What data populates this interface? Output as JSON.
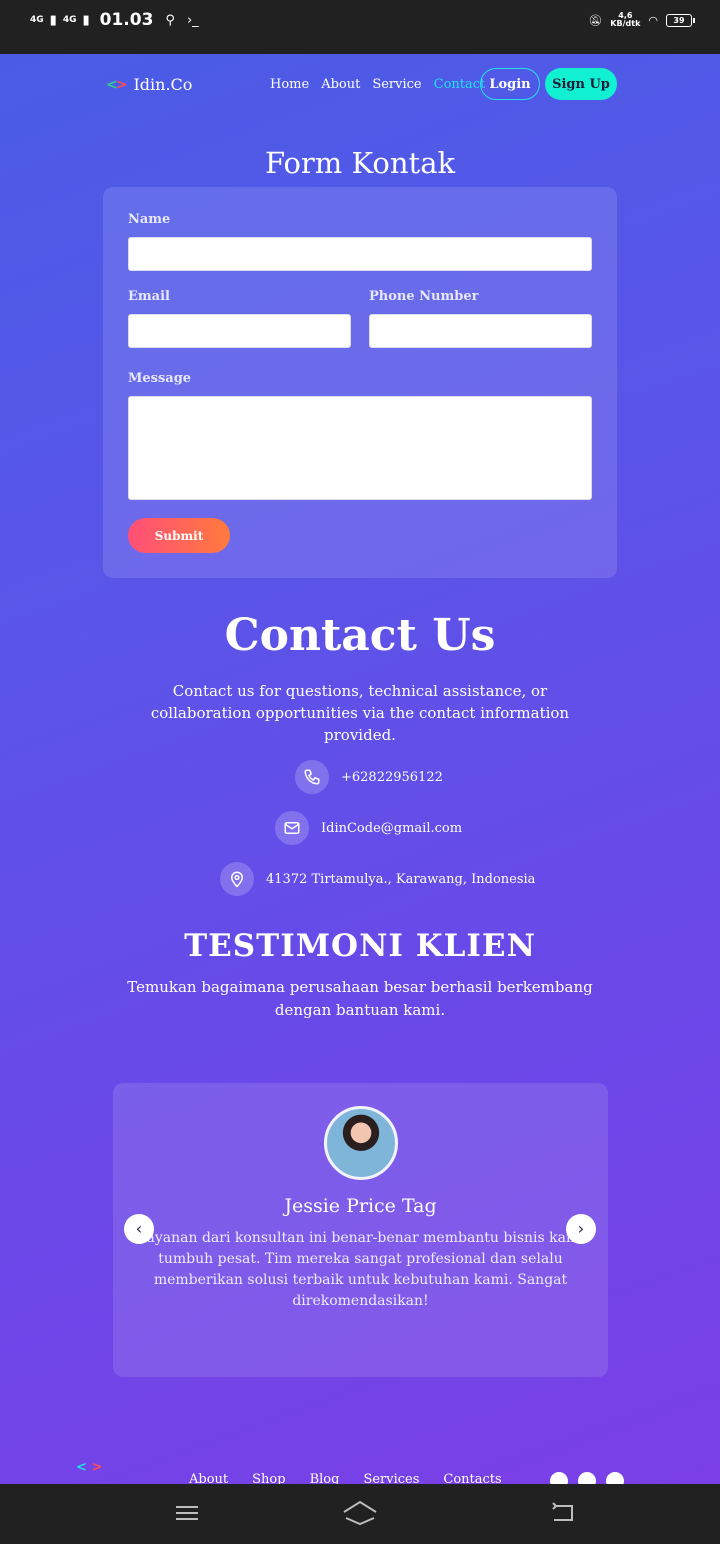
{
  "status_bar": {
    "network_1": "4G",
    "network_2": "4G",
    "time": "01.03",
    "speed_value": "4,6",
    "speed_unit": "KB/dtk",
    "battery": "39"
  },
  "nav": {
    "logo_text": "Idin.Co",
    "menu": [
      "Home",
      "About",
      "Service",
      "Contact"
    ],
    "active_item": "Contact",
    "login_label": "Login",
    "signup_label": "Sign Up"
  },
  "form": {
    "title": "Form Kontak",
    "name_label": "Name",
    "email_label": "Email",
    "phone_label": "Phone Number",
    "message_label": "Message",
    "name_value": "",
    "email_value": "",
    "phone_value": "",
    "message_value": "",
    "submit_label": "Submit"
  },
  "contact": {
    "title": "Contact Us",
    "description": "Contact us for questions, technical assistance, or collaboration opportunities via the contact information provided.",
    "phone": "+62822956122",
    "email": "IdinCode@gmail.com",
    "address": "41372 Tirtamulya., Karawang, Indonesia"
  },
  "testimonials": {
    "title": "TESTIMONI KLIEN",
    "description": "Temukan bagaimana perusahaan besar berhasil berkembang dengan bantuan kami.",
    "current": {
      "name": "Jessie Price Tag",
      "quote": "Layanan dari konsultan ini benar-benar membantu bisnis kami tumbuh pesat. Tim mereka sangat profesional dan selalu memberikan solusi terbaik untuk kebutuhan kami. Sangat direkomendasikan!"
    },
    "prev_arrow": "‹",
    "next_arrow": "›"
  },
  "footer": {
    "links": [
      "About",
      "Shop",
      "Blog",
      "Services",
      "Contacts"
    ],
    "social_icons": [
      "pinterest-icon",
      "instagram-icon",
      "facebook-icon"
    ]
  },
  "colors": {
    "accent_cyan": "#22e1f0",
    "signup_bg": "#12f0d2",
    "submit_gradient_start": "#ff4f78",
    "submit_gradient_end": "#ff7a3d"
  }
}
